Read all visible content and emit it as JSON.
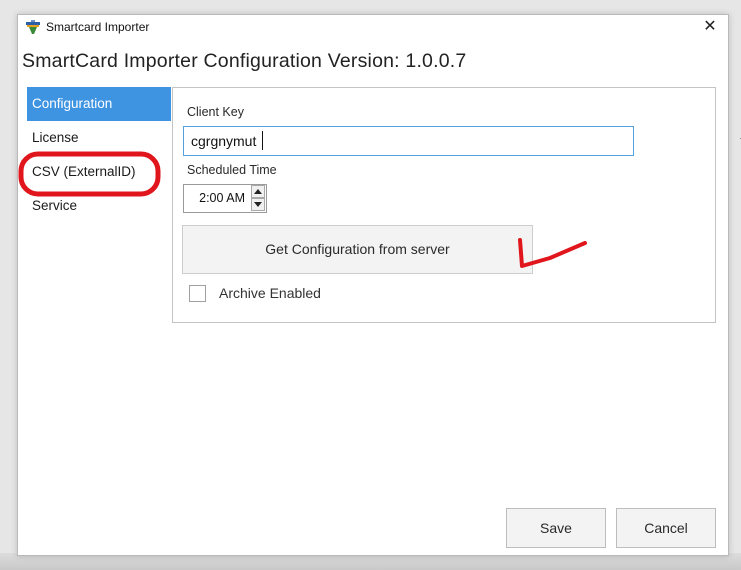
{
  "window": {
    "title": "Smartcard Importer",
    "heading": "SmartCard Importer Configuration Version: 1.0.0.7"
  },
  "nav": {
    "items": [
      {
        "label": "Configuration",
        "active": true
      },
      {
        "label": "License",
        "active": false
      },
      {
        "label": "CSV (ExternalID)",
        "active": false
      },
      {
        "label": "Service",
        "active": false
      }
    ]
  },
  "form": {
    "client_key_label": "Client Key",
    "client_key_value": "cgrgnymut",
    "scheduled_time_label": "Scheduled Time",
    "scheduled_time_value": "2:00 AM",
    "get_config_label": "Get Configuration from server",
    "archive_label": "Archive Enabled",
    "archive_checked": false
  },
  "footer": {
    "save_label": "Save",
    "cancel_label": "Cancel"
  },
  "colors": {
    "accent": "#3f94e2",
    "annotation": "#e0161c"
  },
  "icons": {
    "app": "app-icon",
    "close": "close-icon"
  }
}
